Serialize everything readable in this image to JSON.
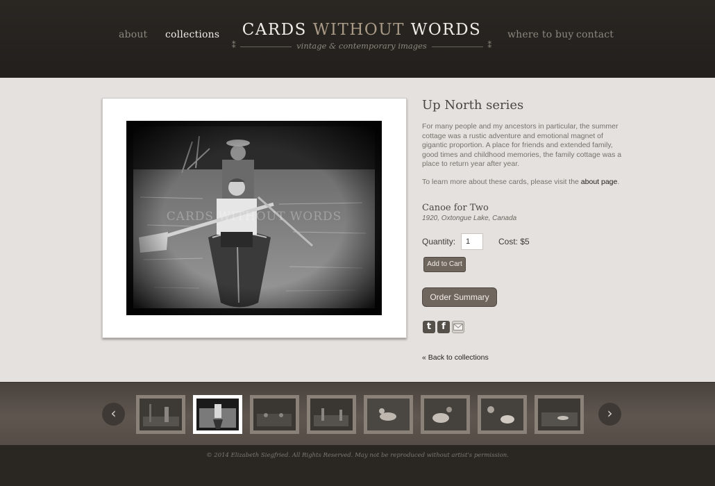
{
  "nav": {
    "about": "about",
    "collections": "collections",
    "where_to_buy": "where to buy",
    "contact": "contact"
  },
  "logo": {
    "word1": "CARDS",
    "word2": "WITHOUT",
    "word3": "WORDS",
    "tagline": "vintage & contemporary images"
  },
  "watermark": "CARDS WITHOUT WORDS",
  "product": {
    "series_title": "Up North series",
    "description": "For many people and my ancestors in particular, the summer cottage was a rustic adventure and emotional magnet of gigantic proportion. A place for friends and extended family, good times and childhood memories, the family cottage was a place to return year after year.",
    "learn_more_prefix": "To learn more about these cards, please visit the ",
    "learn_more_link": "about page",
    "learn_more_suffix": ".",
    "card_title": "Canoe for Two",
    "card_subtitle": "1920, Oxtongue Lake, Canada",
    "quantity_label": "Quantity:",
    "quantity_value": "1",
    "cost_label": "Cost: $5",
    "add_to_cart": "Add to Cart",
    "order_summary": "Order Summary",
    "back_link": "« Back to collections"
  },
  "social": {
    "twitter_icon": "t",
    "facebook_icon": "f",
    "email_icon": "email-icon"
  },
  "thumbnails": {
    "prev_arrow": "‹",
    "next_arrow": "›",
    "count": 8,
    "active_index": 1
  },
  "footer": {
    "copyright": "© 2014 Elizabeth Siegfried. All Rights Reserved. May not be reproduced without artist's permission."
  },
  "colors": {
    "header_bg": "#2a2723",
    "content_bg": "#e5e1de",
    "button_bg": "#6f665e",
    "strip_bg": "#5e564f"
  }
}
